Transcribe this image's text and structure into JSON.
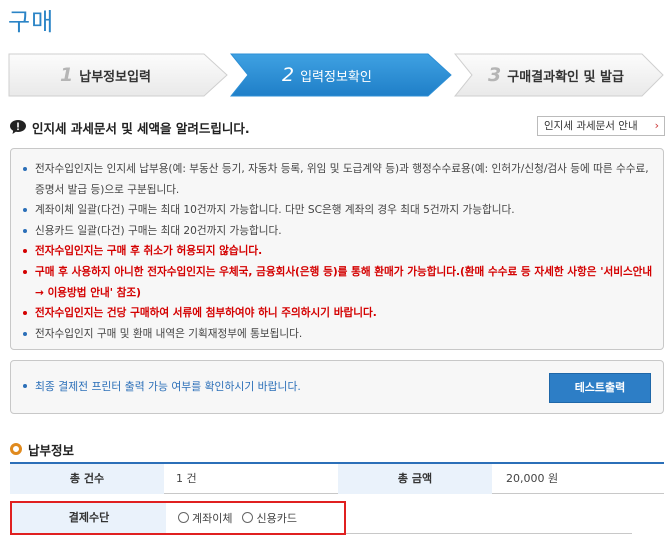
{
  "page": {
    "title": "구매"
  },
  "steps": [
    {
      "number": "1",
      "label": "납부정보입력",
      "state": "inactive"
    },
    {
      "number": "2",
      "label": "입력정보확인",
      "state": "active"
    },
    {
      "number": "3",
      "label": "구매결과확인 및 발급",
      "state": "inactive"
    }
  ],
  "notice": {
    "heading": "인지세 과세문서 및 세액을 알려드립니다.",
    "guide_button": "인지세 과세문서 안내",
    "items": [
      {
        "text": "전자수입인지는 인지세 납부용(예: 부동산 등기, 자동차 등록, 위임 및 도급계약 등)과 행정수수료용(예: 인허가/신청/검사 등에 따른 수수료, 증명서 발급 등)으로 구분됩니다.",
        "emphasis": false
      },
      {
        "text": "계좌이체 일괄(다건) 구매는 최대 10건까지 가능합니다. 다만 SC은행 계좌의 경우 최대 5건까지 가능합니다.",
        "emphasis": false
      },
      {
        "text": "신용카드 일괄(다건) 구매는 최대 20건까지 가능합니다.",
        "emphasis": false
      },
      {
        "text": "전자수입인지는 구매 후 취소가 허용되지 않습니다.",
        "emphasis": true
      },
      {
        "text": "구매 후 사용하지 아니한 전자수입인지는 우체국, 금융회사(은행 등)를 통해 환매가 가능합니다.(환매 수수료 등 자세한 사항은 '서비스안내 → 이용방법 안내' 참조)",
        "emphasis": true
      },
      {
        "text": "전자수입인지는 건당 구매하여 서류에 첨부하여야 하니 주의하시기 바랍니다.",
        "emphasis": true
      },
      {
        "text": "전자수입인지 구매 및 환매 내역은 기획재정부에 통보됩니다.",
        "emphasis": false
      }
    ]
  },
  "print": {
    "text": "최종 결제전 프린터 출력 가능 여부를 확인하시기 바랍니다.",
    "button": "테스트출력"
  },
  "payment": {
    "section_title": "납부정보",
    "total_count_label": "총 건수",
    "total_count_value": "1 건",
    "total_amount_label": "총 금액",
    "total_amount_value": "20,000 원",
    "method_label": "결제수단",
    "methods": [
      "계좌이체",
      "신용카드"
    ]
  },
  "colors": {
    "accent": "#2b84c6",
    "active_step": "#2d8fd5",
    "emphasis": "#d40000",
    "highlight": "#e02020",
    "section_icon": "#e08a1e"
  }
}
